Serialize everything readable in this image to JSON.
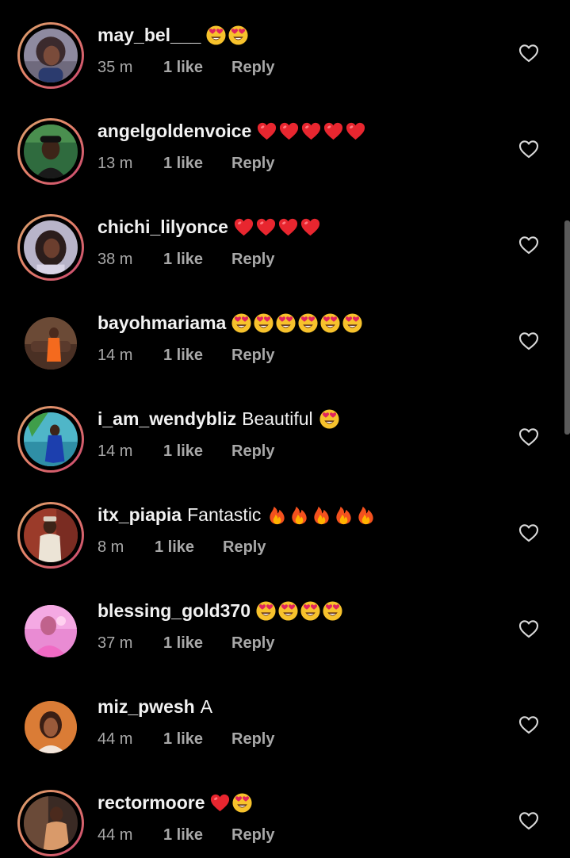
{
  "colors": {
    "background": "#000000",
    "text_primary": "#f2f2f2",
    "text_secondary": "#a8a8a8",
    "story_ring": "#e4826a"
  },
  "icons": {
    "like": "heart-outline-icon",
    "heart_emoji": "red-heart-emoji",
    "heart_eyes_emoji": "smiling-face-with-heart-eyes-emoji",
    "fire_emoji": "fire-emoji"
  },
  "comments": [
    {
      "username": "may_bel___",
      "text": "",
      "emojis": [
        "heart-eyes",
        "heart-eyes"
      ],
      "time": "35 m",
      "likes": "1 like",
      "reply": "Reply",
      "story": true
    },
    {
      "username": "angelgoldenvoice",
      "text": "",
      "emojis": [
        "heart",
        "heart",
        "heart",
        "heart",
        "heart"
      ],
      "time": "13 m",
      "likes": "1 like",
      "reply": "Reply",
      "story": true
    },
    {
      "username": "chichi_lilyonce",
      "text": "",
      "emojis": [
        "heart",
        "heart",
        "heart",
        "heart"
      ],
      "time": "38 m",
      "likes": "1 like",
      "reply": "Reply",
      "story": true
    },
    {
      "username": "bayohmariama",
      "text": "",
      "emojis": [
        "heart-eyes",
        "heart-eyes",
        "heart-eyes",
        "heart-eyes",
        "heart-eyes",
        "heart-eyes"
      ],
      "time": "14 m",
      "likes": "1 like",
      "reply": "Reply",
      "story": false
    },
    {
      "username": "i_am_wendybliz",
      "text": "Beautiful",
      "emojis": [
        "heart-eyes"
      ],
      "time": "14 m",
      "likes": "1 like",
      "reply": "Reply",
      "story": true
    },
    {
      "username": "itx_piapia",
      "text": "Fantastic",
      "emojis": [
        "fire",
        "fire",
        "fire",
        "fire",
        "fire"
      ],
      "time": "8 m",
      "likes": "1 like",
      "reply": "Reply",
      "story": true
    },
    {
      "username": "blessing_gold370",
      "text": "",
      "emojis": [
        "heart-eyes",
        "heart-eyes",
        "heart-eyes",
        "heart-eyes"
      ],
      "time": "37 m",
      "likes": "1 like",
      "reply": "Reply",
      "story": false
    },
    {
      "username": "miz_pwesh",
      "text": "A",
      "emojis": [],
      "time": "44 m",
      "likes": "1 like",
      "reply": "Reply",
      "story": false
    },
    {
      "username": "rectormoore",
      "text": "",
      "emojis": [
        "heart",
        "heart-eyes"
      ],
      "time": "44 m",
      "likes": "1 like",
      "reply": "Reply",
      "story": true
    }
  ]
}
